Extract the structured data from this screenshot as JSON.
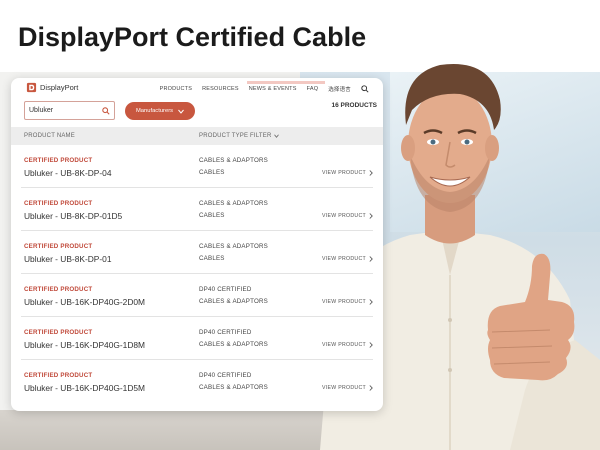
{
  "headline": "DisplayPort Certified Cable",
  "window": {
    "logo_text": "DisplayPort",
    "nav": [
      "PRODUCTS",
      "RESOURCES",
      "NEWS & EVENTS",
      "FAQ",
      "选择语言"
    ],
    "search": {
      "value": "Ubluker"
    },
    "manufacturers_label": "Manufacturers",
    "product_count": "16 PRODUCTS",
    "table": {
      "col_name": "PRODUCT NAME",
      "col_type": "PRODUCT TYPE FILTER",
      "rows": [
        {
          "badge": "CERTIFIED PRODUCT",
          "name": "Ubluker - UB-8K-DP-04",
          "type1": "CABLES & ADAPTORS",
          "type2": "CABLES",
          "action": "VIEW PRODUCT"
        },
        {
          "badge": "CERTIFIED PRODUCT",
          "name": "Ubluker - UB-8K-DP-01D5",
          "type1": "CABLES & ADAPTORS",
          "type2": "CABLES",
          "action": "VIEW PRODUCT"
        },
        {
          "badge": "CERTIFIED PRODUCT",
          "name": "Ubluker - UB-8K-DP-01",
          "type1": "CABLES & ADAPTORS",
          "type2": "CABLES",
          "action": "VIEW PRODUCT"
        },
        {
          "badge": "CERTIFIED PRODUCT",
          "name": "Ubluker - UB-16K-DP40G-2D0M",
          "type1": "DP40 CERTIFIED",
          "type2": "CABLES & ADAPTORS",
          "action": "VIEW PRODUCT"
        },
        {
          "badge": "CERTIFIED PRODUCT",
          "name": "Ubluker - UB-16K-DP40G-1D8M",
          "type1": "DP40 CERTIFIED",
          "type2": "CABLES & ADAPTORS",
          "action": "VIEW PRODUCT"
        },
        {
          "badge": "CERTIFIED PRODUCT",
          "name": "Ubluker - UB-16K-DP40G-1D5M",
          "type1": "DP40 CERTIFIED",
          "type2": "CABLES & ADAPTORS",
          "action": "VIEW PRODUCT"
        }
      ]
    }
  },
  "colors": {
    "accent": "#c8573f",
    "badge": "#c0493a"
  }
}
